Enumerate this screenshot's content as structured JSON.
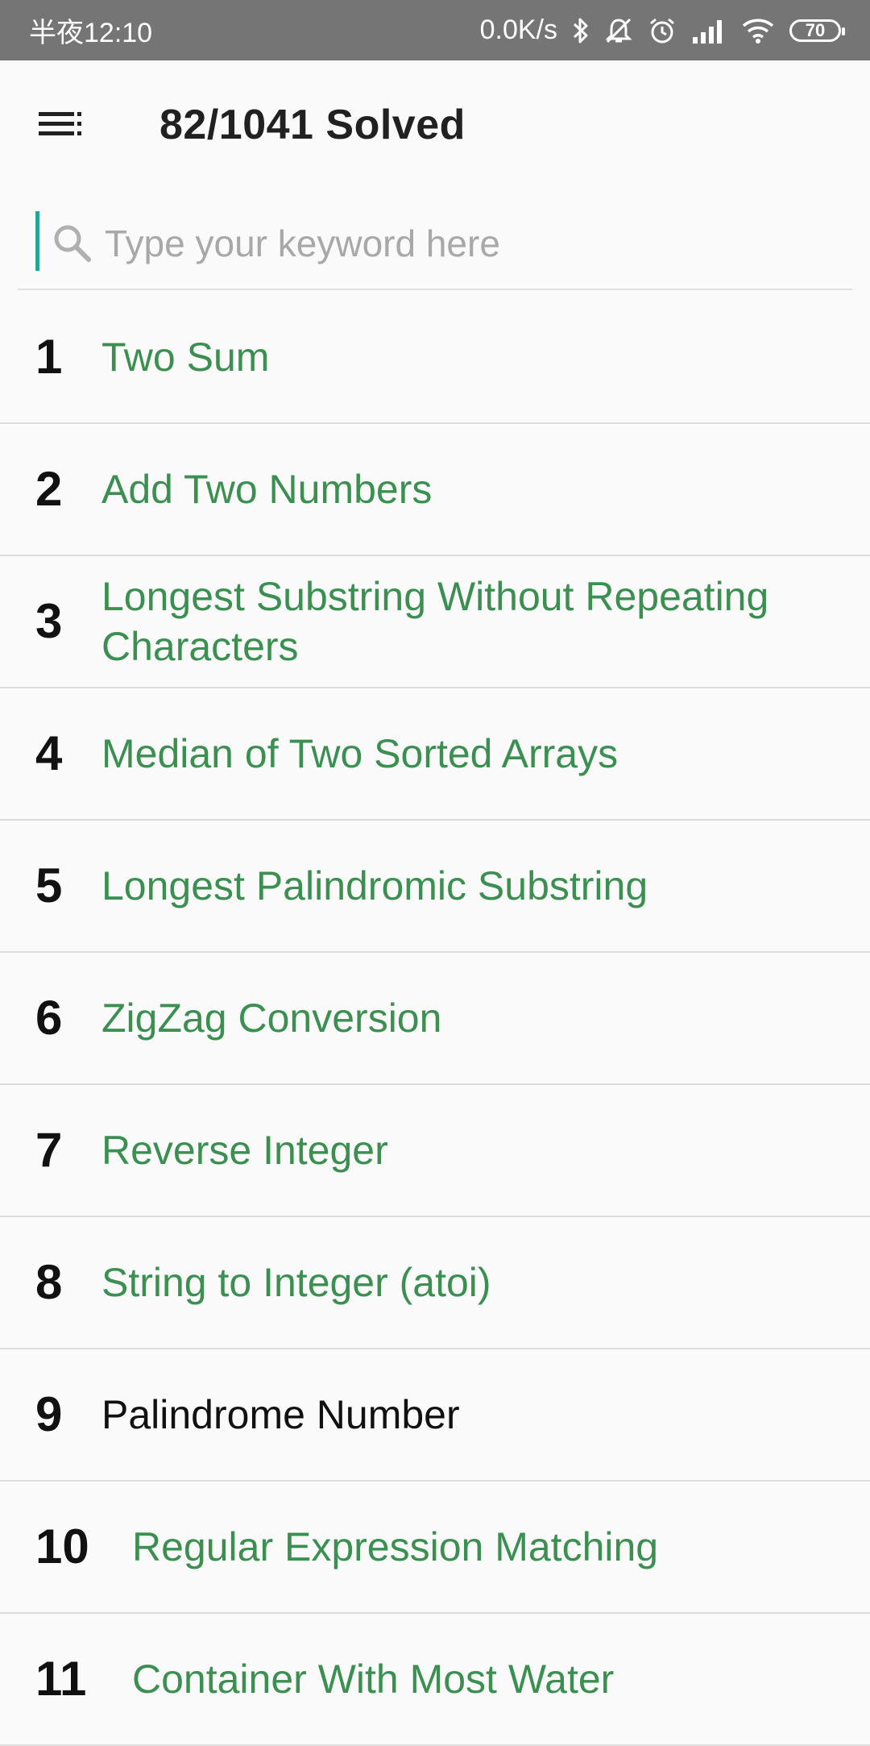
{
  "status_bar": {
    "time": "半夜12:10",
    "network_speed": "0.0K/s",
    "battery": "70",
    "icons": [
      "bluetooth-icon",
      "mute-icon",
      "alarm-icon",
      "signal-icon",
      "wifi-icon",
      "battery-icon"
    ]
  },
  "app_bar": {
    "title": "82/1041 Solved",
    "menu_icon": "menu-icon"
  },
  "search": {
    "placeholder": "Type your keyword here",
    "value": "",
    "icon": "search-icon"
  },
  "colors": {
    "status_bar_bg": "#757575",
    "solved_title": "#3b8f50",
    "unsolved_title": "#111111",
    "cursor_accent": "#26a69a"
  },
  "problems": [
    {
      "number": "1",
      "title": "Two Sum",
      "solved": true
    },
    {
      "number": "2",
      "title": "Add Two Numbers",
      "solved": true
    },
    {
      "number": "3",
      "title": "Longest Substring Without Repeating Characters",
      "solved": true
    },
    {
      "number": "4",
      "title": "Median of Two Sorted Arrays",
      "solved": true
    },
    {
      "number": "5",
      "title": "Longest Palindromic Substring",
      "solved": true
    },
    {
      "number": "6",
      "title": "ZigZag Conversion",
      "solved": true
    },
    {
      "number": "7",
      "title": "Reverse Integer",
      "solved": true
    },
    {
      "number": "8",
      "title": "String to Integer (atoi)",
      "solved": true
    },
    {
      "number": "9",
      "title": "Palindrome Number",
      "solved": false
    },
    {
      "number": "10",
      "title": "Regular Expression Matching",
      "solved": true
    },
    {
      "number": "11",
      "title": "Container With Most Water",
      "solved": true
    }
  ]
}
